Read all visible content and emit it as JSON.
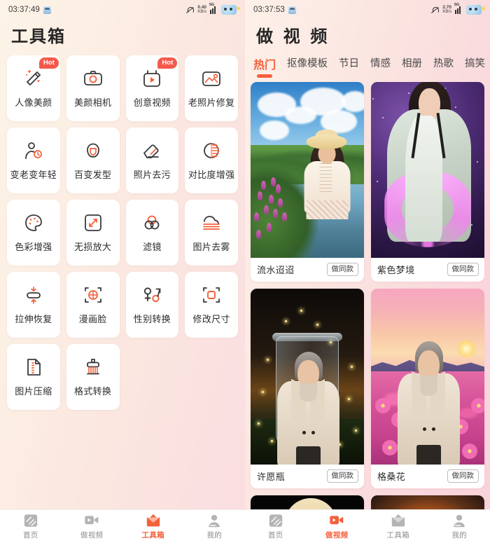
{
  "accent": "#F4603C",
  "hot_badge_color": "#F4584B",
  "left_panel": {
    "status": {
      "time": "03:37:49",
      "net_speed_value": "0.40",
      "net_speed_unit": "KB/s",
      "network_type": "5G"
    },
    "title": "工具箱",
    "tools": [
      {
        "label": "人像美颜",
        "icon": "magic-wand-icon",
        "badge": "Hot"
      },
      {
        "label": "美颜相机",
        "icon": "camera-icon",
        "badge": ""
      },
      {
        "label": "创意视频",
        "icon": "video-play-icon",
        "badge": "Hot"
      },
      {
        "label": "老照片修复",
        "icon": "photo-restore-icon",
        "badge": ""
      },
      {
        "label": "变老变年轻",
        "icon": "age-change-icon",
        "badge": ""
      },
      {
        "label": "百变发型",
        "icon": "hairstyle-icon",
        "badge": ""
      },
      {
        "label": "照片去污",
        "icon": "eraser-icon",
        "badge": ""
      },
      {
        "label": "对比度增强",
        "icon": "contrast-icon",
        "badge": ""
      },
      {
        "label": "色彩增强",
        "icon": "palette-icon",
        "badge": ""
      },
      {
        "label": "无损放大",
        "icon": "expand-icon",
        "badge": ""
      },
      {
        "label": "滤镜",
        "icon": "filter-circles-icon",
        "badge": ""
      },
      {
        "label": "图片去雾",
        "icon": "defog-icon",
        "badge": ""
      },
      {
        "label": "拉伸恢复",
        "icon": "stretch-restore-icon",
        "badge": ""
      },
      {
        "label": "漫画脸",
        "icon": "comic-face-icon",
        "badge": ""
      },
      {
        "label": "性别转换",
        "icon": "gender-swap-icon",
        "badge": ""
      },
      {
        "label": "修改尺寸",
        "icon": "resize-icon",
        "badge": ""
      },
      {
        "label": "图片压缩",
        "icon": "compress-icon",
        "badge": ""
      },
      {
        "label": "格式转换",
        "icon": "format-convert-icon",
        "badge": ""
      }
    ],
    "nav": [
      {
        "label": "首页",
        "icon": "home-icon",
        "active": false
      },
      {
        "label": "做视频",
        "icon": "video-camera-icon",
        "active": false
      },
      {
        "label": "工具箱",
        "icon": "toolbox-icon",
        "active": true
      },
      {
        "label": "我的",
        "icon": "person-icon",
        "active": false
      }
    ]
  },
  "right_panel": {
    "status": {
      "time": "03:37:53",
      "net_speed_value": "2.70",
      "net_speed_unit": "KB/s",
      "network_type": "5G"
    },
    "title": "做 视 频",
    "tabs": [
      {
        "label": "热门",
        "active": true
      },
      {
        "label": "抠像模板",
        "active": false
      },
      {
        "label": "节日",
        "active": false
      },
      {
        "label": "情感",
        "active": false
      },
      {
        "label": "相册",
        "active": false
      },
      {
        "label": "热歌",
        "active": false
      },
      {
        "label": "搞笑",
        "active": false
      }
    ],
    "cards": [
      {
        "title": "流水迢迢",
        "button": "做同款",
        "scene": "river-portrait"
      },
      {
        "title": "紫色梦境",
        "button": "做同款",
        "scene": "purple-dream"
      },
      {
        "title": "许愿瓶",
        "button": "做同款",
        "scene": "wish-bottle"
      },
      {
        "title": "格桑花",
        "button": "做同款",
        "scene": "cosmos-field"
      }
    ],
    "partial_cards": [
      {
        "scene": "dark-hat-portrait"
      },
      {
        "scene": "sunset-glow"
      }
    ],
    "nav": [
      {
        "label": "首页",
        "icon": "home-icon",
        "active": false
      },
      {
        "label": "做视频",
        "icon": "video-camera-icon",
        "active": true
      },
      {
        "label": "工具箱",
        "icon": "toolbox-icon",
        "active": false
      },
      {
        "label": "我的",
        "icon": "person-icon",
        "active": false
      }
    ]
  }
}
